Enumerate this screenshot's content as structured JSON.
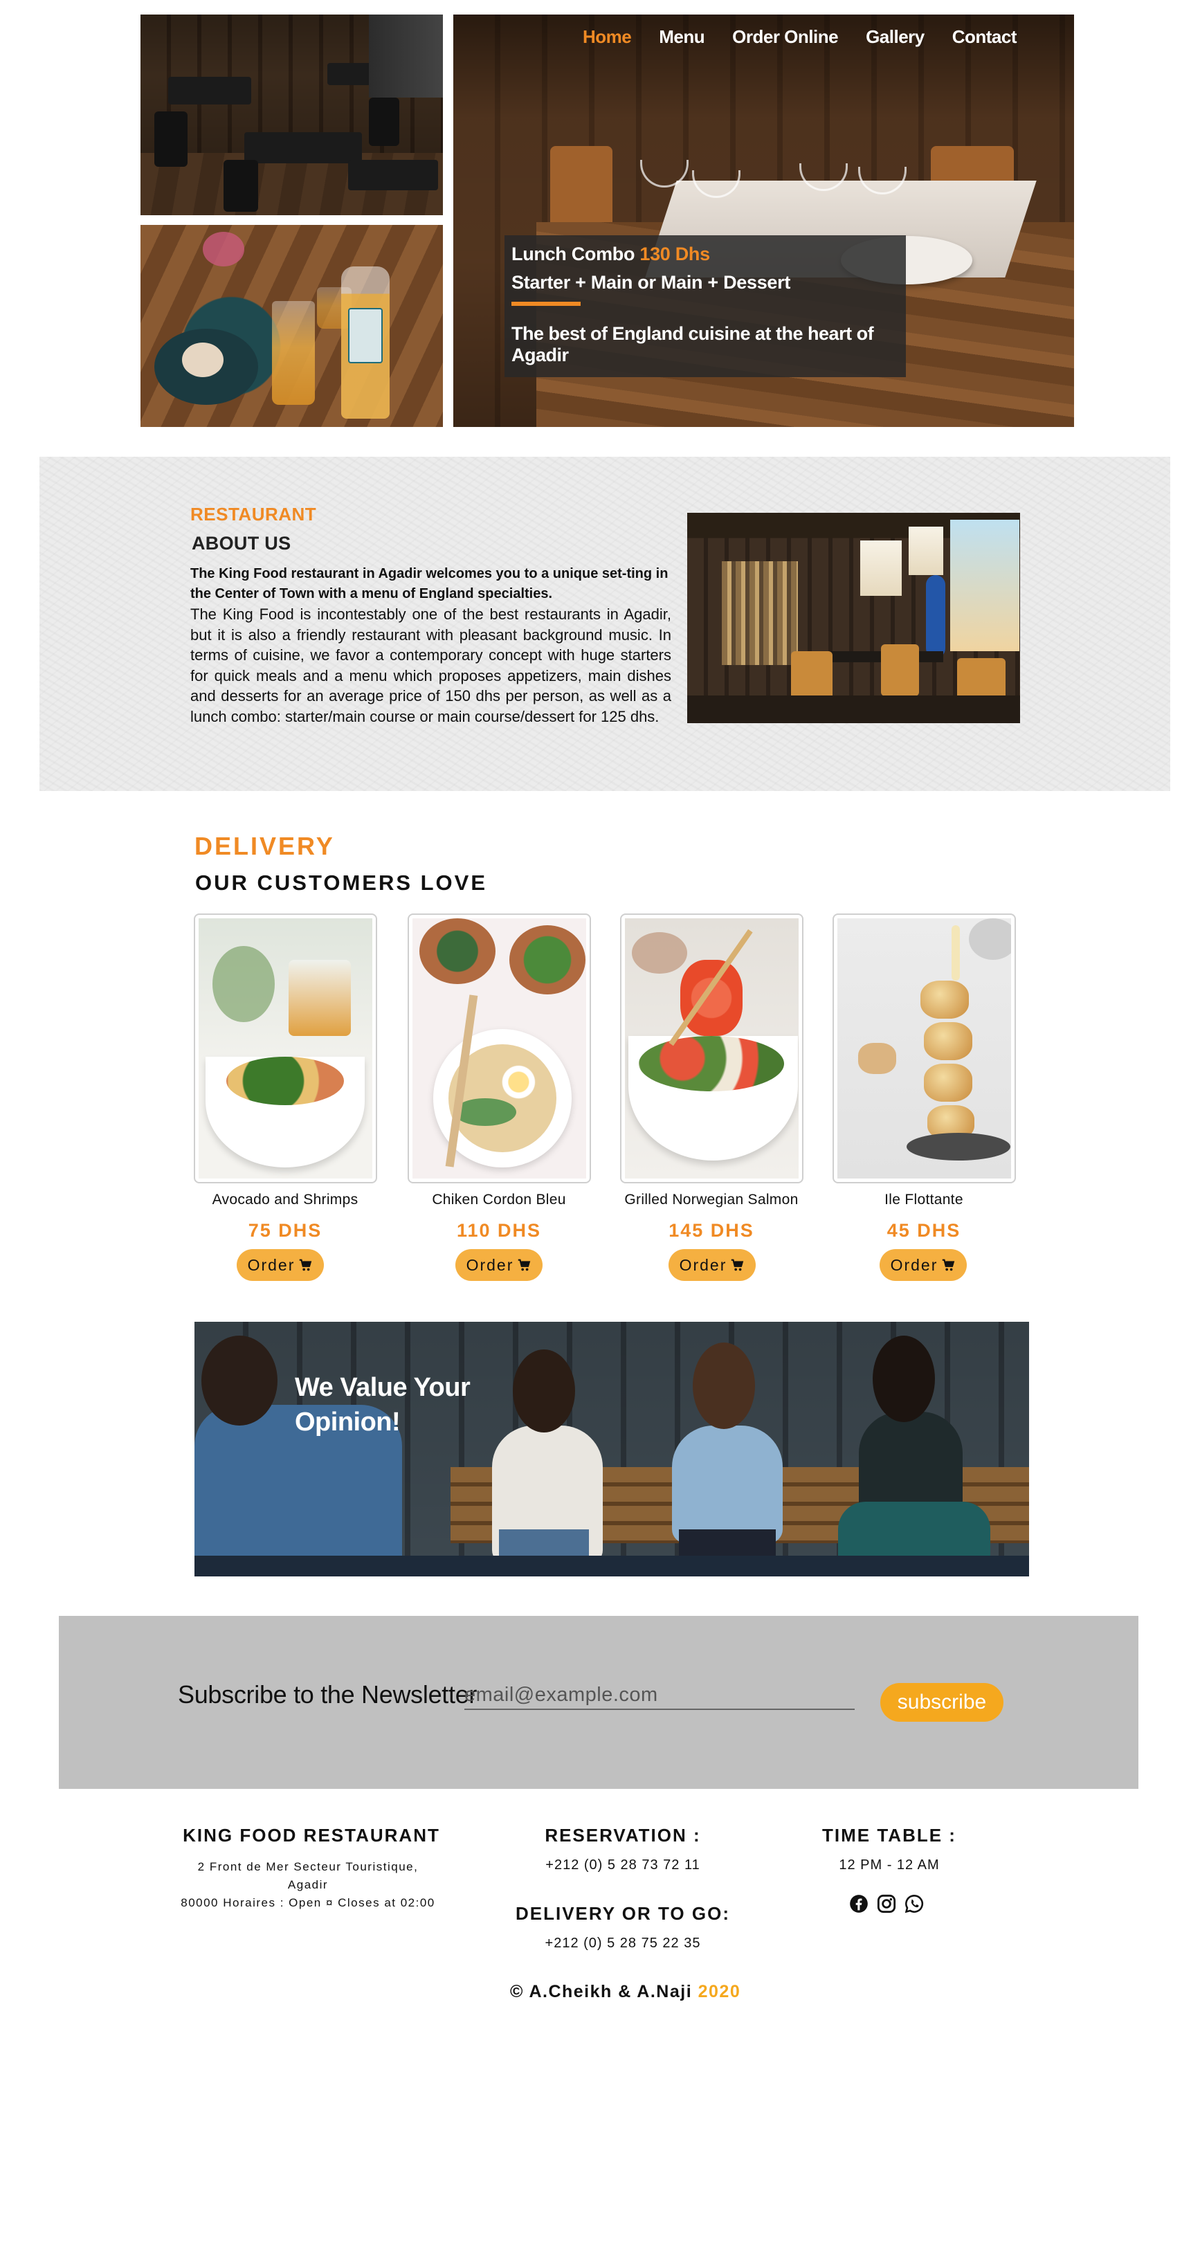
{
  "nav": {
    "items": [
      {
        "label": "Home",
        "active": true
      },
      {
        "label": "Menu",
        "active": false
      },
      {
        "label": "Order Online",
        "active": false
      },
      {
        "label": "Gallery",
        "active": false
      },
      {
        "label": "Contact",
        "active": false
      }
    ]
  },
  "promo": {
    "line1_text": "Lunch Combo ",
    "line1_price": "130 Dhs",
    "line2": "Starter + Main or Main + Dessert",
    "line3": "The best of England cuisine at the heart of Agadir"
  },
  "about": {
    "tag": "RESTAURANT",
    "title": "ABOUT US",
    "lead": "The King Food restaurant in Agadir welcomes you to a unique set-ting in the Center of Town with a menu of England specialties.",
    "body": "The King Food is incontestably one of the best restaurants in Agadir, but it is also a friendly restaurant with pleasant background music. In terms of cuisine, we favor a contemporary concept with huge starters for quick meals and a menu which proposes appetizers, main dishes and desserts for an average price of 150 dhs per person, as well as a lunch combo: starter/main course or main course/dessert for 125 dhs."
  },
  "delivery": {
    "tag": "DELIVERY",
    "title": "OUR CUSTOMERS LOVE",
    "dishes": [
      {
        "name": "Avocado and Shrimps",
        "price": "75 DHS",
        "order_label": "Order"
      },
      {
        "name": "Chiken Cordon Bleu",
        "price": "110 DHS",
        "order_label": "Order"
      },
      {
        "name": "Grilled Norwegian Salmon",
        "price": "145 DHS",
        "order_label": "Order"
      },
      {
        "name": "Ile Flottante",
        "price": "45 DHS",
        "order_label": "Order"
      }
    ]
  },
  "opinion": {
    "line1": "We Value Your",
    "line2": "Opinion!"
  },
  "newsletter": {
    "label": "Subscribe to the Newsletter",
    "placeholder": "email@example.com",
    "button": "subscribe"
  },
  "footer": {
    "restaurant_title": "KING FOOD RESTAURANT",
    "address_line1": "2 Front de Mer Secteur Touristique, Agadir",
    "address_line2": "80000 Horaires : Open ¤ Closes at 02:00",
    "reservation_title": "RESERVATION :",
    "reservation_phone": "+212 (0) 5 28 73 72 11",
    "delivery_title": "DELIVERY OR TO GO:",
    "delivery_phone": "+212 (0) 5 28 75 22 35",
    "timetable_title": "TIME TABLE :",
    "timetable_hours": "12 PM - 12 AM",
    "social": [
      "facebook-icon",
      "instagram-icon",
      "whatsapp-icon"
    ],
    "copyright_names": "© A.Cheikh & A.Naji ",
    "copyright_year": "2020"
  },
  "colors": {
    "accent_orange": "#f08a24",
    "button_yellow": "#f5b041",
    "newsletter_bg": "#c0c0c0"
  }
}
